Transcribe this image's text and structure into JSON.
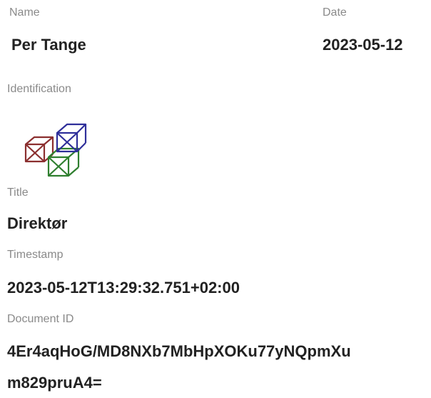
{
  "signer": {
    "name_label": "Name",
    "name_value": "Per Tange",
    "date_label": "Date",
    "date_value": "2023-05-12"
  },
  "identification": {
    "label": "Identification",
    "logo_icon": "interlocking-cubes-logo-icon",
    "logo_colors": [
      "#8b2f2f",
      "#2f2f9a",
      "#2f7f2f"
    ]
  },
  "title": {
    "label": "Title",
    "value": "Direktør"
  },
  "timestamp": {
    "label": "Timestamp",
    "value": "2023-05-12T13:29:32.751+02:00"
  },
  "document": {
    "label": "Document ID",
    "value_line1": "4Er4aqHoG/MD8NXb7MbHpXOKu77yNQpmXu",
    "value_line2": "m829pruA4="
  }
}
